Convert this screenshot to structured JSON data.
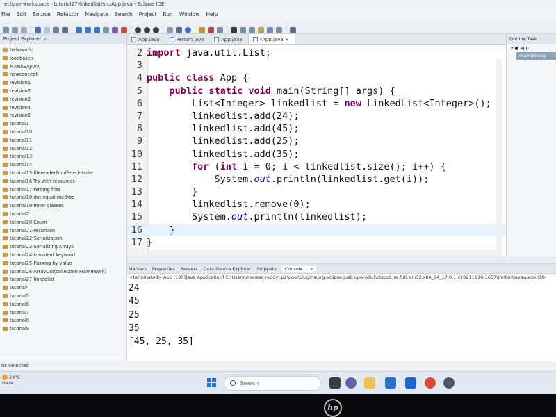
{
  "window": {
    "title": "eclipse-workspace - tutorial27-linkedlist/src/App.java - Eclipse IDE"
  },
  "menu": [
    "File",
    "Edit",
    "Source",
    "Refactor",
    "Navigate",
    "Search",
    "Project",
    "Run",
    "Window",
    "Help"
  ],
  "explorer": {
    "title": "Project Explorer",
    "projects": [
      "helloworld",
      "loopbascis",
      "MANASAJAVA",
      "newconcept",
      "revision1",
      "revision2",
      "revision3",
      "revision4",
      "revision5",
      "tutorial1",
      "tutorial10",
      "tutorial11",
      "tutorial12",
      "tutorial13",
      "tutorial14",
      "tutorial15-filereader&bufferedreader",
      "tutorial16-Try with resources",
      "tutorial17-Writing files",
      "tutorial18-dot equal method",
      "tutorial19-Inner classes",
      "tutorial2",
      "tutorial20-Enum",
      "tutorial21-recursion",
      "tutorial22-Serialization",
      "tutorial23-Serializing Arrays",
      "tutorial24-transient keyword",
      "tutorial25-Passing by value",
      "tutorial26-ArrayList(collection Framework)",
      "tutorial27-linkedlist",
      "tutorial4",
      "tutorial5",
      "tutorial6",
      "tutorial7",
      "tutorial8",
      "tutorial9"
    ]
  },
  "editor": {
    "tabs": [
      {
        "label": "App.java",
        "active": false
      },
      {
        "label": "Person.java",
        "active": false
      },
      {
        "label": "App.java",
        "active": false
      },
      {
        "label": "*App.java",
        "active": true
      }
    ],
    "line_numbers": [
      "2",
      "3",
      "4",
      "5",
      "6",
      "7",
      "8",
      "9",
      "10",
      "11",
      "12",
      "13",
      "14",
      "15",
      "16",
      "17"
    ]
  },
  "outline": {
    "title": "Outline",
    "title2": "Task",
    "class_name": "App",
    "method": "main(String"
  },
  "console": {
    "tabs": [
      "Markers",
      "Properties",
      "Servers",
      "Data Source Explorer",
      "Snippets",
      "Console"
    ],
    "terminated": "<terminated> App (19) [Java Application] C:\\Users\\manasa reddy\\.p2\\pool\\plugins\\org.eclipse.justj.openjdk.hotspot.jre.full.win32.x86_64_17.0.1.v20211116-1657\\jre\\bin\\javaw.exe  (18-",
    "output": [
      "24",
      "45",
      "25",
      "35",
      "[45, 25, 35]"
    ]
  },
  "statusbar": {
    "text": "ns selected"
  },
  "taskbar": {
    "temperature": "24°C",
    "weather": "Haze",
    "search_placeholder": "Search"
  },
  "colors": {
    "keyword": "#7f0055",
    "field": "#0000c0",
    "taskbar": "#e4e9f1"
  }
}
